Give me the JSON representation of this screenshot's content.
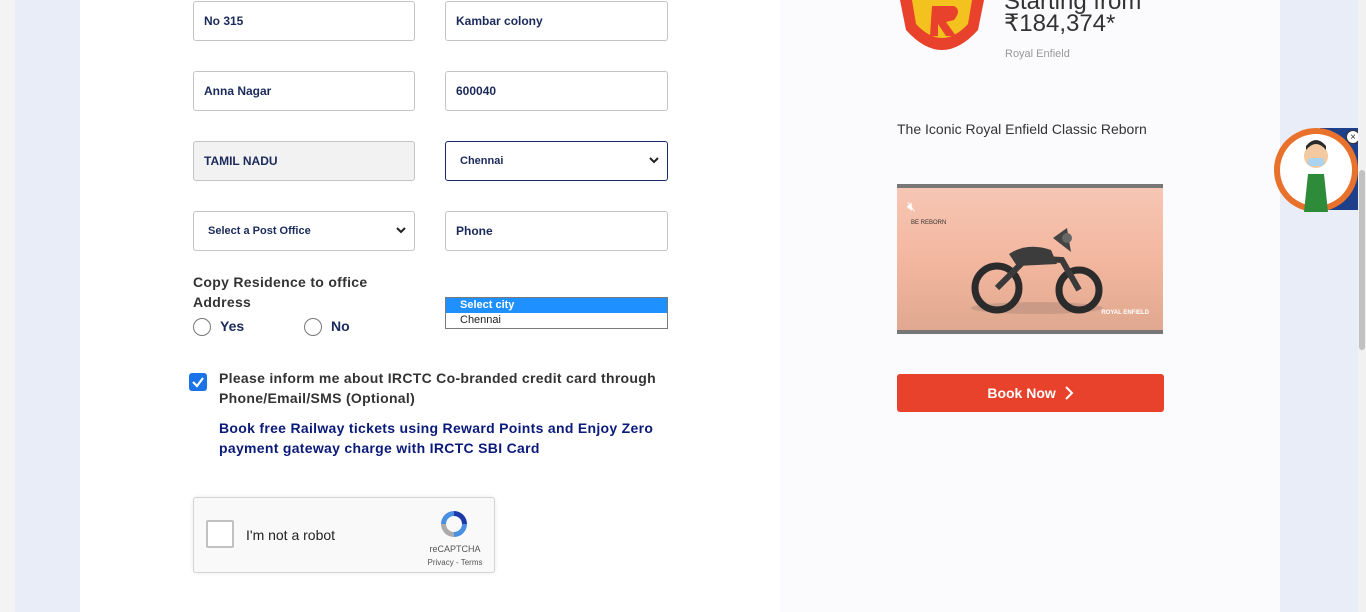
{
  "form": {
    "address1": "No 315",
    "address2": "Kambar colony",
    "area": "Anna Nagar",
    "pincode": "600040",
    "state": "TAMIL NADU",
    "city_selected": "Chennai",
    "post_office_placeholder": "Select a Post Office",
    "phone_placeholder": "Phone",
    "copy_residence_label": "Copy Residence to office Address",
    "radio_yes": "Yes",
    "radio_no": "No",
    "city_options": [
      "Select city",
      "Chennai"
    ],
    "consent_text": "Please inform me about IRCTC Co-branded credit card through Phone/Email/SMS (Optional)",
    "promo_text": "Book free Railway tickets using Reward Points and Enjoy Zero payment gateway charge with IRCTC SBI Card",
    "consent_checked": true
  },
  "captcha": {
    "label": "I'm not a robot",
    "brand": "reCAPTCHA",
    "terms": "Privacy - Terms"
  },
  "ad": {
    "title": "Starting from",
    "price": "₹184,374*",
    "brand": "Royal Enfield",
    "tagline": "The Iconic Royal Enfield Classic Reborn",
    "video_text_1": "BE REBORN",
    "video_text_2": "ROYAL ENFIELD",
    "cta": "Book Now",
    "cta_color": "#e8412c"
  },
  "icons": {
    "chevron": "chevron-down-icon",
    "mute": "mute-icon",
    "arrow": "chevron-right-icon",
    "close": "close-icon"
  }
}
